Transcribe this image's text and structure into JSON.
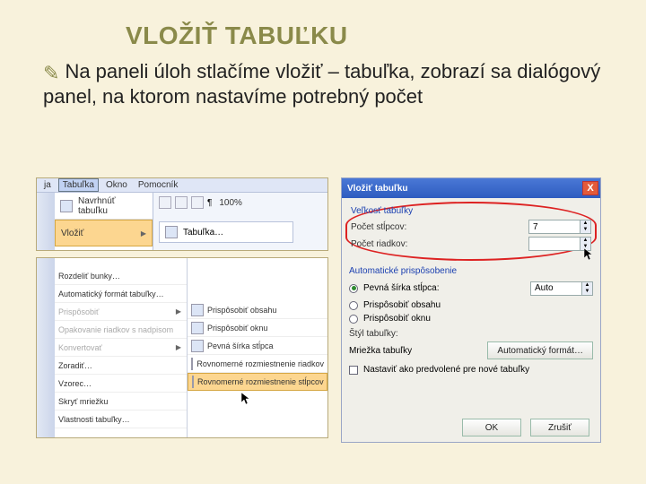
{
  "title": "VLOŽIŤ TABUĽKU",
  "bullet_glyph": "✎",
  "body": "Na paneli úloh stlačíme vložiť – tabuľka, zobrazí sa dialógový panel, na ktorom nastavíme potrebný počet",
  "fig_menu": {
    "menubar": [
      "ja",
      "Tabuľka",
      "Okno",
      "Pomocník"
    ],
    "selected_menu_index": 1,
    "items": [
      "Navrhnúť tabuľku",
      "Vložiť"
    ],
    "selected_item_index": 1,
    "submenu_item": "Tabuľka…",
    "zoom": "100%",
    "zoom_icon": "¶"
  },
  "fig_context": {
    "items": [
      {
        "label": "Rozdeliť bunky…",
        "disabled": false,
        "arrow": false
      },
      {
        "label": "Automatický formát tabuľky…",
        "disabled": false,
        "arrow": false
      },
      {
        "label": "Prispôsobiť",
        "disabled": true,
        "arrow": true
      },
      {
        "label": "Opakovanie riadkov s nadpisom",
        "disabled": true,
        "arrow": false
      },
      {
        "label": "Konvertovať",
        "disabled": true,
        "arrow": true
      },
      {
        "label": "Zoradiť…",
        "disabled": false,
        "arrow": false
      },
      {
        "label": "Vzorec…",
        "disabled": false,
        "arrow": false
      },
      {
        "label": "Skryť mriežku",
        "disabled": false,
        "arrow": false
      },
      {
        "label": "Vlastnosti tabuľky…",
        "disabled": false,
        "arrow": false
      }
    ],
    "submenu": [
      "Prispôsobiť obsahu",
      "Prispôsobiť oknu",
      "Pevná šírka stĺpca",
      "Rovnomerné rozmiestnenie riadkov",
      "Rovnomerné rozmiestnenie stĺpcov"
    ],
    "submenu_selected_index": 4
  },
  "fig_dialog": {
    "title": "Vložiť tabuľku",
    "close_glyph": "X",
    "group_size": "Veľkosť tabuľky",
    "cols_label": "Počet stĺpcov:",
    "cols_value": "7",
    "rows_label": "Počet riadkov:",
    "rows_value": "",
    "group_autofit": "Automatické prispôsobenie",
    "radio_fixed": "Pevná šírka stĺpca:",
    "fixed_value": "Auto",
    "radio_content": "Prispôsobiť obsahu",
    "radio_window": "Prispôsobiť oknu",
    "style_label": "Štýl tabuľky:",
    "style_value": "Mriežka tabuľky",
    "autofmt_btn": "Automatický formát…",
    "remember_label": "Nastaviť ako predvolené pre nové tabuľky",
    "ok": "OK",
    "cancel": "Zrušiť",
    "selected_radio": 0
  }
}
